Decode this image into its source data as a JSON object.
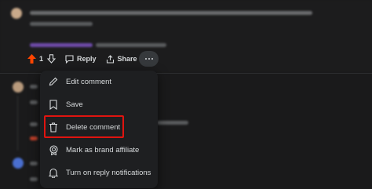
{
  "comment_actions": {
    "score": "1",
    "reply_label": "Reply",
    "share_label": "Share"
  },
  "context_menu": {
    "items": [
      {
        "label": "Edit comment",
        "icon": "pencil-icon"
      },
      {
        "label": "Save",
        "icon": "bookmark-icon"
      },
      {
        "label": "Delete comment",
        "icon": "trash-icon",
        "highlighted": true
      },
      {
        "label": "Mark as brand affiliate",
        "icon": "brand-affiliate-icon"
      },
      {
        "label": "Turn on reply notifications",
        "icon": "bell-icon"
      }
    ]
  },
  "colors": {
    "background": "#1a1a1b",
    "upvote": "#ff4500",
    "highlight_border": "#e0140f"
  }
}
